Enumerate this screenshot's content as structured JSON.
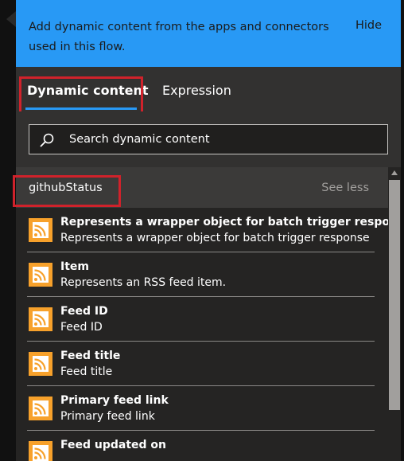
{
  "banner": {
    "text": "Add dynamic content from the apps and connectors used in this flow.",
    "hide_label": "Hide"
  },
  "tabs": [
    {
      "label": "Dynamic content",
      "active": true
    },
    {
      "label": "Expression",
      "active": false
    }
  ],
  "search": {
    "placeholder": "Search dynamic content",
    "value": ""
  },
  "section": {
    "title": "githubStatus",
    "toggle_label": "See less"
  },
  "items": [
    {
      "title": "Represents a wrapper object for batch trigger response",
      "description": "Represents a wrapper object for batch trigger response",
      "icon": "rss-icon"
    },
    {
      "title": "Item",
      "description": "Represents an RSS feed item.",
      "icon": "rss-icon"
    },
    {
      "title": "Feed ID",
      "description": "Feed ID",
      "icon": "rss-icon"
    },
    {
      "title": "Feed title",
      "description": "Feed title",
      "icon": "rss-icon"
    },
    {
      "title": "Primary feed link",
      "description": "Primary feed link",
      "icon": "rss-icon"
    },
    {
      "title": "Feed updated on",
      "description": "",
      "icon": "rss-icon"
    }
  ],
  "colors": {
    "banner": "#2899f5",
    "highlight": "#d0222b",
    "rss_icon": "#f7a12b",
    "panel": "#252423"
  }
}
